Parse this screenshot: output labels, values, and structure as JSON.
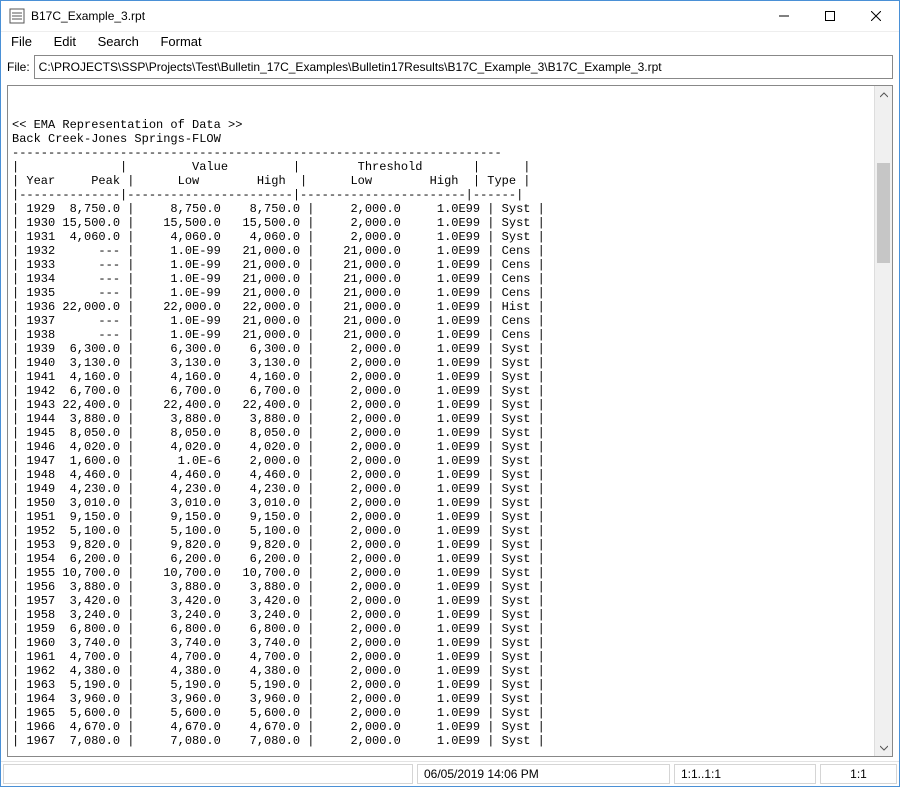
{
  "window": {
    "title": "B17C_Example_3.rpt"
  },
  "menu": {
    "file": "File",
    "edit": "Edit",
    "search": "Search",
    "format": "Format"
  },
  "file_row": {
    "label": "File:",
    "path": "C:\\PROJECTS\\SSP\\Projects\\Test\\Bulletin_17C_Examples\\Bulletin17Results\\B17C_Example_3\\B17C_Example_3.rpt"
  },
  "report": {
    "section_title": "<< EMA Representation of Data >>",
    "subtitle": "Back Creek-Jones Springs-FLOW",
    "columns": {
      "year": "Year",
      "peak": "Peak",
      "value_group": "Value",
      "value_low": "Low",
      "value_high": "High",
      "threshold_group": "Threshold",
      "threshold_low": "Low",
      "threshold_high": "High",
      "type": "Type"
    },
    "rows": [
      {
        "year": "1929",
        "peak": "8,750.0",
        "vlow": "8,750.0",
        "vhigh": "8,750.0",
        "tlow": "2,000.0",
        "thigh": "1.0E99",
        "type": "Syst"
      },
      {
        "year": "1930",
        "peak": "15,500.0",
        "vlow": "15,500.0",
        "vhigh": "15,500.0",
        "tlow": "2,000.0",
        "thigh": "1.0E99",
        "type": "Syst"
      },
      {
        "year": "1931",
        "peak": "4,060.0",
        "vlow": "4,060.0",
        "vhigh": "4,060.0",
        "tlow": "2,000.0",
        "thigh": "1.0E99",
        "type": "Syst"
      },
      {
        "year": "1932",
        "peak": "---",
        "vlow": "1.0E-99",
        "vhigh": "21,000.0",
        "tlow": "21,000.0",
        "thigh": "1.0E99",
        "type": "Cens"
      },
      {
        "year": "1933",
        "peak": "---",
        "vlow": "1.0E-99",
        "vhigh": "21,000.0",
        "tlow": "21,000.0",
        "thigh": "1.0E99",
        "type": "Cens"
      },
      {
        "year": "1934",
        "peak": "---",
        "vlow": "1.0E-99",
        "vhigh": "21,000.0",
        "tlow": "21,000.0",
        "thigh": "1.0E99",
        "type": "Cens"
      },
      {
        "year": "1935",
        "peak": "---",
        "vlow": "1.0E-99",
        "vhigh": "21,000.0",
        "tlow": "21,000.0",
        "thigh": "1.0E99",
        "type": "Cens"
      },
      {
        "year": "1936",
        "peak": "22,000.0",
        "vlow": "22,000.0",
        "vhigh": "22,000.0",
        "tlow": "21,000.0",
        "thigh": "1.0E99",
        "type": "Hist"
      },
      {
        "year": "1937",
        "peak": "---",
        "vlow": "1.0E-99",
        "vhigh": "21,000.0",
        "tlow": "21,000.0",
        "thigh": "1.0E99",
        "type": "Cens"
      },
      {
        "year": "1938",
        "peak": "---",
        "vlow": "1.0E-99",
        "vhigh": "21,000.0",
        "tlow": "21,000.0",
        "thigh": "1.0E99",
        "type": "Cens"
      },
      {
        "year": "1939",
        "peak": "6,300.0",
        "vlow": "6,300.0",
        "vhigh": "6,300.0",
        "tlow": "2,000.0",
        "thigh": "1.0E99",
        "type": "Syst"
      },
      {
        "year": "1940",
        "peak": "3,130.0",
        "vlow": "3,130.0",
        "vhigh": "3,130.0",
        "tlow": "2,000.0",
        "thigh": "1.0E99",
        "type": "Syst"
      },
      {
        "year": "1941",
        "peak": "4,160.0",
        "vlow": "4,160.0",
        "vhigh": "4,160.0",
        "tlow": "2,000.0",
        "thigh": "1.0E99",
        "type": "Syst"
      },
      {
        "year": "1942",
        "peak": "6,700.0",
        "vlow": "6,700.0",
        "vhigh": "6,700.0",
        "tlow": "2,000.0",
        "thigh": "1.0E99",
        "type": "Syst"
      },
      {
        "year": "1943",
        "peak": "22,400.0",
        "vlow": "22,400.0",
        "vhigh": "22,400.0",
        "tlow": "2,000.0",
        "thigh": "1.0E99",
        "type": "Syst"
      },
      {
        "year": "1944",
        "peak": "3,880.0",
        "vlow": "3,880.0",
        "vhigh": "3,880.0",
        "tlow": "2,000.0",
        "thigh": "1.0E99",
        "type": "Syst"
      },
      {
        "year": "1945",
        "peak": "8,050.0",
        "vlow": "8,050.0",
        "vhigh": "8,050.0",
        "tlow": "2,000.0",
        "thigh": "1.0E99",
        "type": "Syst"
      },
      {
        "year": "1946",
        "peak": "4,020.0",
        "vlow": "4,020.0",
        "vhigh": "4,020.0",
        "tlow": "2,000.0",
        "thigh": "1.0E99",
        "type": "Syst"
      },
      {
        "year": "1947",
        "peak": "1,600.0",
        "vlow": "1.0E-6",
        "vhigh": "2,000.0",
        "tlow": "2,000.0",
        "thigh": "1.0E99",
        "type": "Syst"
      },
      {
        "year": "1948",
        "peak": "4,460.0",
        "vlow": "4,460.0",
        "vhigh": "4,460.0",
        "tlow": "2,000.0",
        "thigh": "1.0E99",
        "type": "Syst"
      },
      {
        "year": "1949",
        "peak": "4,230.0",
        "vlow": "4,230.0",
        "vhigh": "4,230.0",
        "tlow": "2,000.0",
        "thigh": "1.0E99",
        "type": "Syst"
      },
      {
        "year": "1950",
        "peak": "3,010.0",
        "vlow": "3,010.0",
        "vhigh": "3,010.0",
        "tlow": "2,000.0",
        "thigh": "1.0E99",
        "type": "Syst"
      },
      {
        "year": "1951",
        "peak": "9,150.0",
        "vlow": "9,150.0",
        "vhigh": "9,150.0",
        "tlow": "2,000.0",
        "thigh": "1.0E99",
        "type": "Syst"
      },
      {
        "year": "1952",
        "peak": "5,100.0",
        "vlow": "5,100.0",
        "vhigh": "5,100.0",
        "tlow": "2,000.0",
        "thigh": "1.0E99",
        "type": "Syst"
      },
      {
        "year": "1953",
        "peak": "9,820.0",
        "vlow": "9,820.0",
        "vhigh": "9,820.0",
        "tlow": "2,000.0",
        "thigh": "1.0E99",
        "type": "Syst"
      },
      {
        "year": "1954",
        "peak": "6,200.0",
        "vlow": "6,200.0",
        "vhigh": "6,200.0",
        "tlow": "2,000.0",
        "thigh": "1.0E99",
        "type": "Syst"
      },
      {
        "year": "1955",
        "peak": "10,700.0",
        "vlow": "10,700.0",
        "vhigh": "10,700.0",
        "tlow": "2,000.0",
        "thigh": "1.0E99",
        "type": "Syst"
      },
      {
        "year": "1956",
        "peak": "3,880.0",
        "vlow": "3,880.0",
        "vhigh": "3,880.0",
        "tlow": "2,000.0",
        "thigh": "1.0E99",
        "type": "Syst"
      },
      {
        "year": "1957",
        "peak": "3,420.0",
        "vlow": "3,420.0",
        "vhigh": "3,420.0",
        "tlow": "2,000.0",
        "thigh": "1.0E99",
        "type": "Syst"
      },
      {
        "year": "1958",
        "peak": "3,240.0",
        "vlow": "3,240.0",
        "vhigh": "3,240.0",
        "tlow": "2,000.0",
        "thigh": "1.0E99",
        "type": "Syst"
      },
      {
        "year": "1959",
        "peak": "6,800.0",
        "vlow": "6,800.0",
        "vhigh": "6,800.0",
        "tlow": "2,000.0",
        "thigh": "1.0E99",
        "type": "Syst"
      },
      {
        "year": "1960",
        "peak": "3,740.0",
        "vlow": "3,740.0",
        "vhigh": "3,740.0",
        "tlow": "2,000.0",
        "thigh": "1.0E99",
        "type": "Syst"
      },
      {
        "year": "1961",
        "peak": "4,700.0",
        "vlow": "4,700.0",
        "vhigh": "4,700.0",
        "tlow": "2,000.0",
        "thigh": "1.0E99",
        "type": "Syst"
      },
      {
        "year": "1962",
        "peak": "4,380.0",
        "vlow": "4,380.0",
        "vhigh": "4,380.0",
        "tlow": "2,000.0",
        "thigh": "1.0E99",
        "type": "Syst"
      },
      {
        "year": "1963",
        "peak": "5,190.0",
        "vlow": "5,190.0",
        "vhigh": "5,190.0",
        "tlow": "2,000.0",
        "thigh": "1.0E99",
        "type": "Syst"
      },
      {
        "year": "1964",
        "peak": "3,960.0",
        "vlow": "3,960.0",
        "vhigh": "3,960.0",
        "tlow": "2,000.0",
        "thigh": "1.0E99",
        "type": "Syst"
      },
      {
        "year": "1965",
        "peak": "5,600.0",
        "vlow": "5,600.0",
        "vhigh": "5,600.0",
        "tlow": "2,000.0",
        "thigh": "1.0E99",
        "type": "Syst"
      },
      {
        "year": "1966",
        "peak": "4,670.0",
        "vlow": "4,670.0",
        "vhigh": "4,670.0",
        "tlow": "2,000.0",
        "thigh": "1.0E99",
        "type": "Syst"
      },
      {
        "year": "1967",
        "peak": "7,080.0",
        "vlow": "7,080.0",
        "vhigh": "7,080.0",
        "tlow": "2,000.0",
        "thigh": "1.0E99",
        "type": "Syst"
      }
    ]
  },
  "status": {
    "p1": "",
    "p2": "06/05/2019 14:06 PM",
    "p3": "1:1..1:1",
    "p4": "1:1"
  }
}
